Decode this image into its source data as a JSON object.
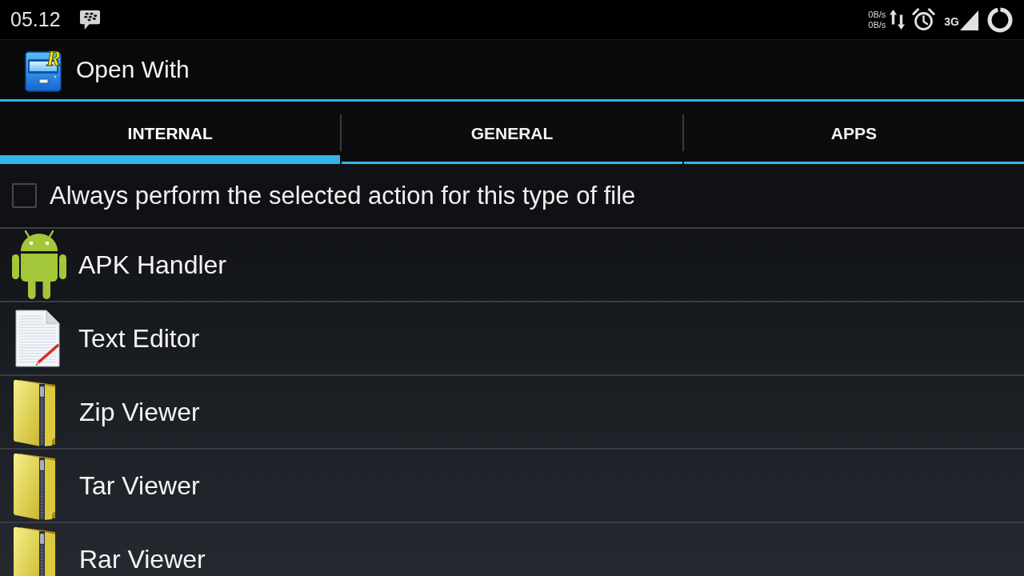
{
  "status_bar": {
    "time": "05.12",
    "data_speeds": [
      "0B/s",
      "0B/s"
    ],
    "network_type": "3G"
  },
  "action_bar": {
    "logo_letter": "R",
    "title": "Open With"
  },
  "tabs": [
    {
      "label": "INTERNAL",
      "selected": true
    },
    {
      "label": "GENERAL",
      "selected": false
    },
    {
      "label": "APPS",
      "selected": false
    }
  ],
  "always_option": {
    "label": "Always perform the selected action for this type of file",
    "checked": false
  },
  "handlers": [
    {
      "kind": "apk",
      "label": "APK Handler"
    },
    {
      "kind": "document",
      "label": "Text Editor"
    },
    {
      "kind": "archive",
      "label": "Zip Viewer"
    },
    {
      "kind": "archive",
      "label": "Tar Viewer"
    },
    {
      "kind": "archive",
      "label": "Rar Viewer"
    }
  ]
}
